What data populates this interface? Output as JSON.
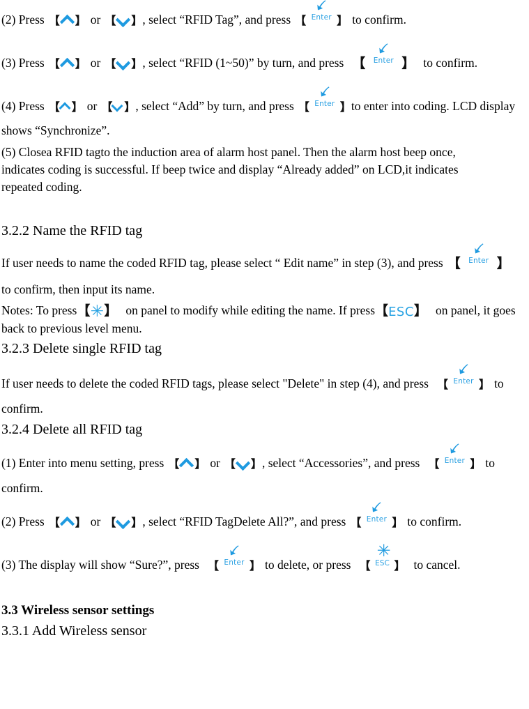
{
  "document": {
    "type": "user-manual-page",
    "language": "en",
    "accent_color": "#1e9ae0",
    "text_color": "#000000",
    "background_color": "#ffffff"
  },
  "icons": {
    "up": "chevron-up-icon",
    "down": "chevron-down-icon",
    "enter": "enter-key-icon",
    "esc": "esc-key-icon",
    "asterisk": "asterisk-key-icon",
    "bracket_left": "【",
    "bracket_right": "】"
  },
  "keys": {
    "enter_label": "Enter",
    "esc_label": "ESC",
    "esc_label_large": "ESC",
    "asterisk_glyph": "✳"
  },
  "steps": {
    "step2": {
      "prefix": "(2) Press",
      "mid_or": "or",
      "after": ",  select “RFID Tag”, and press",
      "tail": "to confirm."
    },
    "step3": {
      "prefix": "(3) Press",
      "mid_or": "or",
      "after": ", select “RFID (1~50)” by turn, and press",
      "tail": "to confirm."
    },
    "step4": {
      "prefix": "(4) Press",
      "mid_or": "or",
      "after": ", select “Add” by turn, and press",
      "tail": "to enter into coding. LCD display",
      "line2": "shows “Synchronize”."
    },
    "step5": {
      "line1": "(5) Closea RFID tagto the induction area of alarm host panel. Then the alarm host beep once,",
      "line2": "indicates coding is successful. If beep twice and display “Already added” on LCD,it indicates",
      "line3": "repeated coding."
    }
  },
  "section_322": {
    "heading": "3.2.2 Name the RFID tag",
    "body_prefix": "If user needs to name the coded RFID tag, please select “ Edit name” in step (3), and press",
    "body_line2": "to confirm, then input its name.",
    "notes_prefix": "Notes: To press",
    "notes_mid": "on panel to modify while editing the name. If press",
    "notes_tail": "on panel, it goes",
    "notes_line2": "back to previous level menu."
  },
  "section_323": {
    "heading": "3.2.3 Delete single RFID tag",
    "body_prefix": "If user needs to delete the coded RFID tags, please select \"Delete\" in step (4), and press",
    "body_tail": "to",
    "body_line2": "confirm."
  },
  "section_324": {
    "heading": "3.2.4 Delete all RFID tag",
    "step1": {
      "prefix": "(1) Enter into menu setting, press",
      "mid_or": "or",
      "after": ", select “Accessories”, and press",
      "tail": "to",
      "line2": "confirm."
    },
    "step2": {
      "prefix": "(2) Press",
      "mid_or": "or",
      "after": ",  select “RFID TagDelete All?”, and press",
      "tail": "to confirm."
    },
    "step3": {
      "prefix": "(3) The display will show “Sure?”, press",
      "mid": "to delete, or press",
      "tail": "to cancel."
    }
  },
  "section_33": {
    "heading": "3.3 Wireless sensor settings",
    "subheading": "3.3.1 Add Wireless sensor"
  }
}
